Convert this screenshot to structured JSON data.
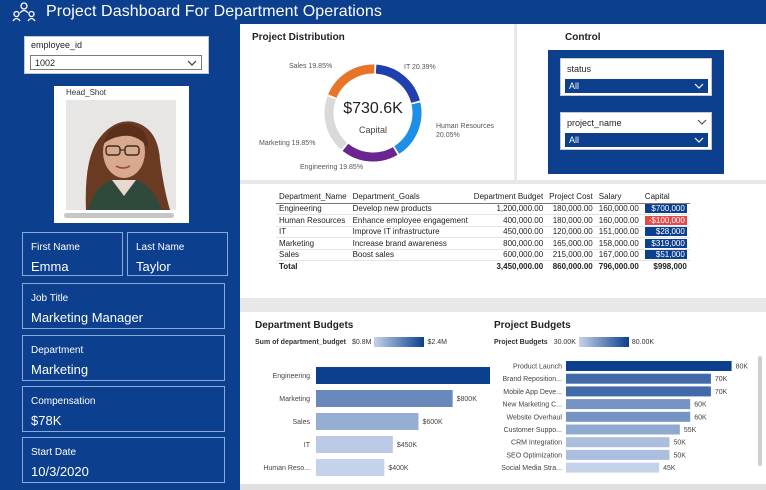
{
  "header": {
    "title": "Project Dashboard For Department Operations"
  },
  "employee_slicer": {
    "label": "employee_id",
    "value": "1002"
  },
  "photo": {
    "label": "Head_Shot"
  },
  "employee": {
    "first_name_label": "First Name",
    "first_name": "Emma",
    "last_name_label": "Last Name",
    "last_name": "Taylor",
    "job_title_label": "Job Title",
    "job_title": "Marketing Manager",
    "department_label": "Department",
    "department": "Marketing",
    "compensation_label": "Compensation",
    "compensation": "$78K",
    "start_date_label": "Start Date",
    "start_date": "10/3/2020"
  },
  "distribution": {
    "title": "Project Distribution",
    "center_value": "$730.6K",
    "center_label": "Capital",
    "slices": [
      {
        "label": "IT 20.39%",
        "color": "#1f3fae"
      },
      {
        "label": "Human Resources 20.05%",
        "color": "#1e8fe8"
      },
      {
        "label": "Engineering 19.85%",
        "color": "#6a2592"
      },
      {
        "label": "Marketing 19.85%",
        "color": "#d9d9d9"
      },
      {
        "label": "Sales 19.85%",
        "color": "#e8742a"
      }
    ]
  },
  "control": {
    "title": "Control",
    "status_label": "status",
    "status_value": "All",
    "project_label": "project_name",
    "project_value": "All"
  },
  "table": {
    "headers": [
      "Department_Name",
      "Department_Goals",
      "Department Budget",
      "Project Cost",
      "Salary",
      "Capital"
    ],
    "rows": [
      {
        "name": "Engineering",
        "goal": "Develop new products",
        "budget": "1,200,000.00",
        "cost": "180,000.00",
        "salary": "160,000.00",
        "capital": "$700,000",
        "color": "#0d3f8f"
      },
      {
        "name": "Human Resources",
        "goal": "Enhance employee engagement",
        "budget": "400,000.00",
        "cost": "180,000.00",
        "salary": "160,000.00",
        "capital": "-$100,000",
        "color": "#e04a4a"
      },
      {
        "name": "IT",
        "goal": "Improve IT infrastructure",
        "budget": "450,000.00",
        "cost": "120,000.00",
        "salary": "151,000.00",
        "capital": "$28,000",
        "color": "#0d3f8f"
      },
      {
        "name": "Marketing",
        "goal": "Increase brand awareness",
        "budget": "800,000.00",
        "cost": "165,000.00",
        "salary": "158,000.00",
        "capital": "$319,000",
        "color": "#0d3f8f"
      },
      {
        "name": "Sales",
        "goal": "Boost sales",
        "budget": "600,000.00",
        "cost": "215,000.00",
        "salary": "167,000.00",
        "capital": "$51,000",
        "color": "#0d3f8f"
      }
    ],
    "total": {
      "name": "Total",
      "budget": "3,450,000.00",
      "cost": "860,000.00",
      "salary": "796,000.00",
      "capital": "$998,000"
    }
  },
  "dept_budgets": {
    "title": "Department Budgets",
    "legend_label": "Sum of department_budget",
    "legend_min": "$0.8M",
    "legend_max": "$2.4M"
  },
  "project_budgets": {
    "title": "Project Budgets",
    "legend_label": "Project Budgets",
    "legend_min": "30.00K",
    "legend_max": "80.00K"
  },
  "chart_data": [
    {
      "type": "bar",
      "title": "Department Budgets",
      "categories": [
        "Engineering",
        "Marketing",
        "Sales",
        "IT",
        "Human Reso..."
      ],
      "values": [
        1200,
        800,
        600,
        450,
        400
      ],
      "labels": [
        "$1,200K",
        "$800K",
        "$600K",
        "$450K",
        "$400K"
      ],
      "unit": "K"
    },
    {
      "type": "bar",
      "title": "Project Budgets",
      "categories": [
        "Product Launch",
        "Brand Reposition...",
        "Mobile App Deve...",
        "New Marketing C...",
        "Website Overhaul",
        "Customer Suppo...",
        "CRM Integration",
        "SEO Optimization",
        "Social Media Stra..."
      ],
      "values": [
        80,
        70,
        70,
        60,
        60,
        55,
        50,
        50,
        45
      ],
      "labels": [
        "80K",
        "70K",
        "70K",
        "60K",
        "60K",
        "55K",
        "50K",
        "50K",
        "45K"
      ],
      "unit": "K"
    }
  ]
}
